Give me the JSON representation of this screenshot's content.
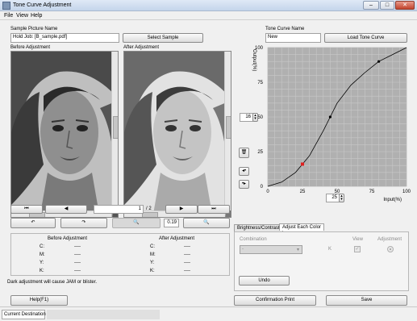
{
  "window": {
    "title": "Tone Curve Adjustment",
    "minimize": "–",
    "maximize": "□",
    "close": "✕"
  },
  "menu": [
    "File",
    "View",
    "Help"
  ],
  "sample": {
    "label": "Sample Picture Name",
    "value": "Hold Job: [B_sample.pdf]",
    "select_button": "Select Sample"
  },
  "preview": {
    "before_label": "Before Adjustment",
    "after_label": "After Adjustment"
  },
  "nav": {
    "page_value": "1",
    "page_total": "/ 2",
    "zoom": "0.19"
  },
  "cmyk_table": {
    "before_header": "Before Adjustment",
    "after_header": "After Adjustment",
    "rows": [
      {
        "label": "C:",
        "before": "----",
        "after": "----"
      },
      {
        "label": "M:",
        "before": "----",
        "after": "----"
      },
      {
        "label": "Y:",
        "before": "----",
        "after": "----"
      },
      {
        "label": "K:",
        "before": "----",
        "after": "----"
      }
    ]
  },
  "warning": "Dark adjustment will cause JAM or blister.",
  "tone": {
    "label": "Tone Curve Name",
    "value": "New",
    "load_button": "Load Tone Curve",
    "output_value": "16",
    "input_value": "25"
  },
  "chart_data": {
    "type": "line",
    "xlabel": "Input(%)",
    "ylabel": "Output(%)",
    "xlim": [
      0,
      100
    ],
    "ylim": [
      0,
      100
    ],
    "grid": true,
    "x_ticks": [
      0,
      25,
      50,
      75,
      100
    ],
    "y_ticks": [
      0,
      25,
      50,
      75,
      100
    ],
    "curve": [
      [
        0,
        0
      ],
      [
        10,
        3
      ],
      [
        20,
        10
      ],
      [
        25,
        16
      ],
      [
        30,
        22
      ],
      [
        40,
        40
      ],
      [
        45,
        50
      ],
      [
        50,
        60
      ],
      [
        60,
        73
      ],
      [
        70,
        82
      ],
      [
        80,
        90
      ],
      [
        90,
        95
      ],
      [
        100,
        100
      ]
    ],
    "control_points": [
      {
        "x": 25,
        "y": 16,
        "selected": true
      },
      {
        "x": 45,
        "y": 50,
        "selected": false
      },
      {
        "x": 80,
        "y": 90,
        "selected": false
      }
    ],
    "colors": {
      "plot_bg": "#b0b0b0",
      "grid": "#c8c8c8",
      "curve": "#000000",
      "selected_point": "#e02020"
    }
  },
  "tabs": [
    "Brightness/Contrast",
    "Adjust Each Color"
  ],
  "each_color": {
    "combination_label": "Combination",
    "view_label": "View",
    "adjustment_label": "Adjustment",
    "combination_value": "-",
    "channel": "K",
    "undo_button": "Undo"
  },
  "footer": {
    "help_button": "Help(F1)",
    "confirm_button": "Confirmation Print",
    "save_button": "Save"
  },
  "status": {
    "label": "Current Destination",
    "value": ""
  }
}
